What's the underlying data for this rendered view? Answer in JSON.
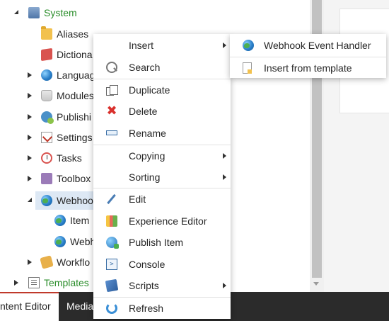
{
  "tree": {
    "items": [
      {
        "label": "System",
        "color": "#2a8d2a"
      },
      {
        "label": "Aliases"
      },
      {
        "label": "Dictiona"
      },
      {
        "label": "Languag"
      },
      {
        "label": "Modules"
      },
      {
        "label": "Publishi"
      },
      {
        "label": "Settings"
      },
      {
        "label": "Tasks"
      },
      {
        "label": "Toolbox"
      },
      {
        "label": "Webhoo"
      },
      {
        "label": "Item"
      },
      {
        "label": "Webh"
      },
      {
        "label": "Workflo"
      },
      {
        "label": "Templates",
        "color": "#2a8d2a"
      }
    ]
  },
  "context_menu": {
    "items": [
      {
        "label": "Insert",
        "icon": "none",
        "submenu": true
      },
      {
        "label": "Search",
        "icon": "search-icon"
      },
      {
        "label": "Duplicate",
        "icon": "duplicate-icon"
      },
      {
        "label": "Delete",
        "icon": "delete-icon"
      },
      {
        "label": "Rename",
        "icon": "rename-icon"
      },
      {
        "label": "Copying",
        "icon": "none",
        "submenu": true
      },
      {
        "label": "Sorting",
        "icon": "none",
        "submenu": true
      },
      {
        "label": "Edit",
        "icon": "edit-icon"
      },
      {
        "label": "Experience Editor",
        "icon": "experience-editor-icon"
      },
      {
        "label": "Publish Item",
        "icon": "publish-icon"
      },
      {
        "label": "Console",
        "icon": "console-icon"
      },
      {
        "label": "Scripts",
        "icon": "scripts-icon",
        "submenu": true
      },
      {
        "label": "Refresh",
        "icon": "refresh-icon"
      }
    ]
  },
  "insert_submenu": {
    "items": [
      {
        "label": "Webhook Event Handler",
        "icon": "webhook-icon"
      },
      {
        "label": "Insert from template",
        "icon": "template-page-icon"
      }
    ]
  },
  "tabs": [
    {
      "label": "ntent Editor",
      "active": true
    },
    {
      "label": "Media"
    }
  ],
  "colors": {
    "accent_tab": "#c0392b",
    "tabbar": "#2b2b2b",
    "tree_green": "#2a8d2a"
  }
}
